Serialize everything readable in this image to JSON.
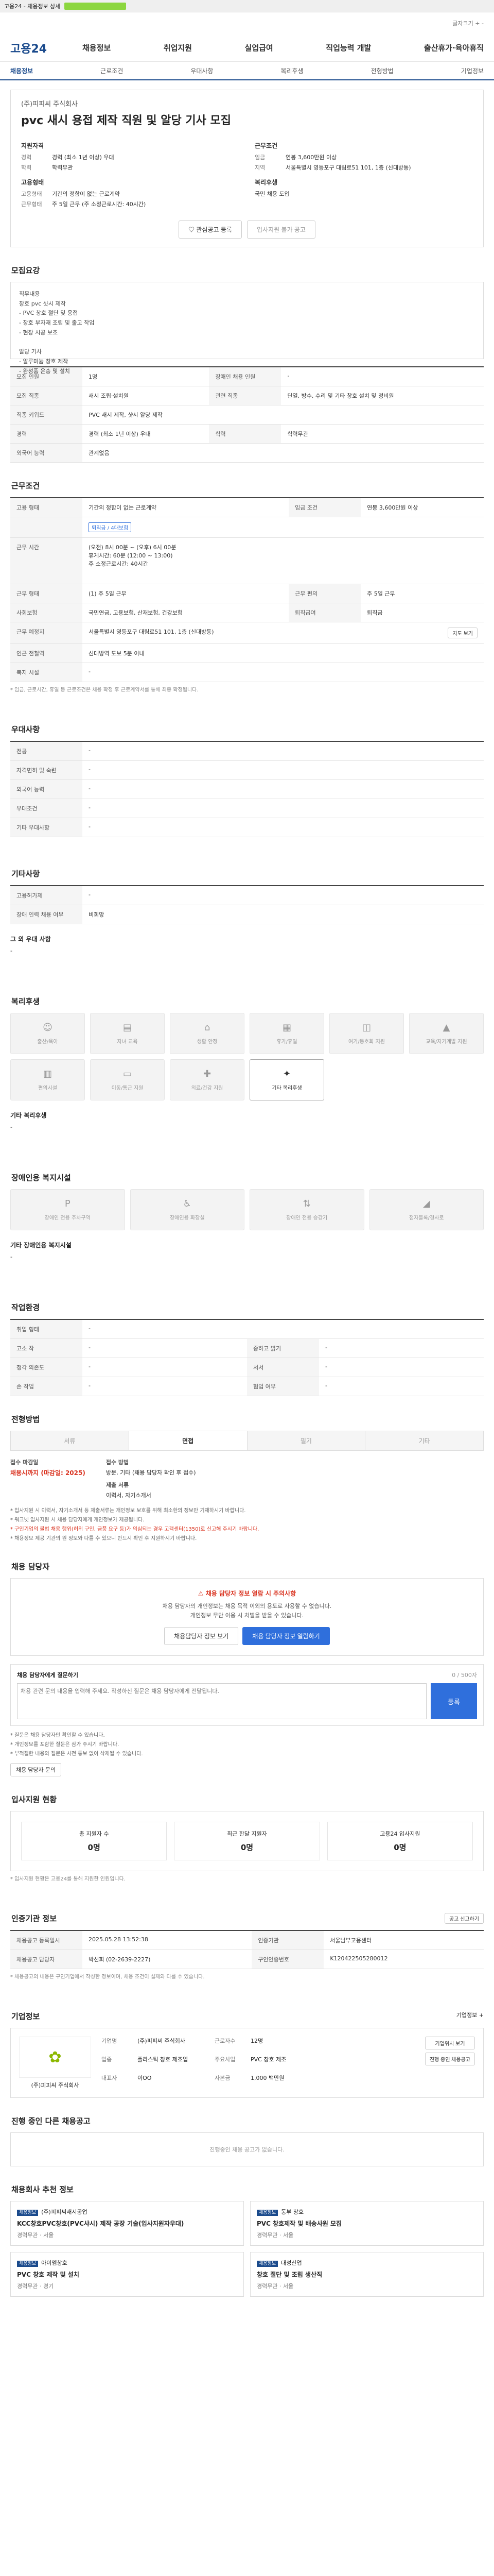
{
  "topbar": {
    "text": "고용24 - 채용정보 상세"
  },
  "util": {
    "font_label": "글자크기",
    "plus": "+",
    "minus": "-"
  },
  "gnb": {
    "logo": "고용24",
    "menu": [
      "채용정보",
      "취업지원",
      "실업급여",
      "직업능력 개발",
      "출산휴가·육아휴직"
    ]
  },
  "tabs": [
    "채용정보",
    "근로조건",
    "우대사항",
    "복리후생",
    "전형방법",
    "기업정보"
  ],
  "hero": {
    "company": "(주)피피씨 주식회사",
    "title": "pvc 새시 용접 제작 직원 및 알당 기사 모집",
    "left_title": "지원자격",
    "left": [
      {
        "k": "경력",
        "v": "경력 (최소 1년 이상) 우대"
      },
      {
        "k": "학력",
        "v": "학력무관"
      }
    ],
    "right_title": "근무조건",
    "right": [
      {
        "k": "임금",
        "v": "연봉 3,600만원 이상"
      },
      {
        "k": "지역",
        "v": "서울특별시 영등포구 대림로51 101, 1층 (신대방동)"
      }
    ],
    "left2_title": "고용형태",
    "left2": [
      {
        "k": "고용형태",
        "v": "기간의 정함이 없는 근로계약"
      },
      {
        "k": "근무형태",
        "v": "주 5일 근무 (주 소정근로시간: 40시간)"
      }
    ],
    "right2_title": "복리후생",
    "right2": [
      {
        "k": "",
        "v": "국민 채용 도입"
      }
    ],
    "btn_scrap": "관심공고 등록",
    "btn_apply": "입사지원 불가 공고"
  },
  "recruit": {
    "title": "모집요강",
    "content": "직무내용\n창호 pvc 샷시 제작\n- PVC 창호 절단 및 용접\n- 창호 부자재 조립 및 출고 작업\n- 현장 시공 보조\n\n알당 기사\n- 알루미늄 창호 제작\n- 완성품 운송 및 설치",
    "rows": [
      {
        "k1": "모집 인원",
        "v1": "1명",
        "k2": "장애인 채용 인원",
        "v2": "-"
      },
      {
        "k1": "모집 직종",
        "v1": "새시 조립·설치원",
        "k2": "관련 직종",
        "v2": "단열, 방수, 수리 및 기타 창호 설치 및 정비원"
      },
      {
        "k1": "직종 키워드",
        "v1": "PVC 새시 제작, 샷시 알당 제작",
        "k2": "",
        "v2": ""
      },
      {
        "k1": "경력",
        "v1": "경력 (최소 1년 이상) 우대",
        "k2": "학력",
        "v2": "학력무관"
      },
      {
        "k1": "외국어 능력",
        "v1": "관계없음",
        "k2": "",
        "v2": ""
      }
    ]
  },
  "conditions": {
    "title": "근무조건",
    "rows": [
      {
        "k": "고용 형태",
        "v": "기간의 정함이 없는 근로계약",
        "k2": "임금 조건",
        "v2": "연봉 3,600만원 이상"
      },
      {
        "k": "",
        "v": "퇴직금 / 4대보험",
        "k2": "",
        "v2": ""
      },
      {
        "k": "근무 시간",
        "v": "(오전) 8시 00분 ~ (오후) 6시 00분\n휴게시간: 60분 (12:00 ~ 13:00)\n주 소정근로시간: 40시간",
        "k2": "",
        "v2": ""
      },
      {
        "k": "근무 형태",
        "v": "(1) 주 5일 근무",
        "k2": "근무 편의",
        "v2": "주 5일 근무"
      },
      {
        "k": "사회보험",
        "v": "국민연금, 고용보험, 산재보험, 건강보험",
        "k2": "퇴직급여",
        "v2": "퇴직금"
      },
      {
        "k": "근무 예정지",
        "v": "서울특별시 영등포구 대림로51 101, 1층 (신대방동)",
        "k2": "",
        "v2": ""
      },
      {
        "k": "인근 전철역",
        "v": "신대방역 도보 5분 이내",
        "k2": "",
        "v2": ""
      },
      {
        "k": "복지 시설",
        "v": "-",
        "k2": "",
        "v2": ""
      }
    ],
    "map_btn": "지도 보기",
    "note": "* 임금, 근로시간, 휴일 등 근로조건은 채용 확정 후 근로계약서를 통해 최종 확정됩니다."
  },
  "prefer": {
    "title": "우대사항",
    "rows": [
      {
        "k": "전공",
        "v": "-"
      },
      {
        "k": "자격면허 및 숙련",
        "v": "-"
      },
      {
        "k": "외국어 능력",
        "v": "-"
      },
      {
        "k": "우대조건",
        "v": "-"
      },
      {
        "k": "기타 우대사항",
        "v": "-"
      }
    ]
  },
  "etc": {
    "title": "기타사항",
    "rows": [
      {
        "k": "고용허가제",
        "v": "-"
      },
      {
        "k": "장애 인력 채용 여부",
        "v": "비희망"
      }
    ],
    "extra_k": "그 외 우대 사항",
    "extra_v": "-"
  },
  "welfare": {
    "title": "복리후생",
    "items": [
      {
        "label": "출산/육아",
        "icon": "baby-icon",
        "on": false
      },
      {
        "label": "자녀 교육",
        "icon": "book-icon",
        "on": false
      },
      {
        "label": "생활 안정",
        "icon": "home-icon",
        "on": false
      },
      {
        "label": "휴가/휴일",
        "icon": "calendar-icon",
        "on": false
      },
      {
        "label": "여가/동호회 지원",
        "icon": "bag-icon",
        "on": false
      },
      {
        "label": "교육/자기계발 지원",
        "icon": "graduation-icon",
        "on": false
      },
      {
        "label": "편의시설",
        "icon": "building-icon",
        "on": false
      },
      {
        "label": "이동/통근 지원",
        "icon": "bus-icon",
        "on": false
      },
      {
        "label": "의료/건강 지원",
        "icon": "medical-icon",
        "on": false
      },
      {
        "label": "기타 복리후생",
        "icon": "gift-icon",
        "on": true
      }
    ],
    "extra_k": "기타 복리후생",
    "extra_v": "-"
  },
  "disabled": {
    "title": "장애인용 복지시설",
    "items": [
      "장애인 전용 주차구역",
      "장애인용 화장실",
      "장애인 전용 승강기",
      "점자블록/경사로"
    ],
    "extra_k": "기타 장애인용 복지시설",
    "extra_v": "-"
  },
  "worktype": {
    "title": "작업환경",
    "rows": [
      {
        "k": "취업 형태",
        "v": "-",
        "k2": "",
        "v2": ""
      },
      {
        "k": "고소 작",
        "v": "-",
        "k2": "중하고 밝기",
        "v2": "-"
      },
      {
        "k": "청각 의존도",
        "v": "-",
        "k2": "서서",
        "v2": "-"
      },
      {
        "k": "손 작업",
        "v": "-",
        "k2": "협업 여부",
        "v2": "-"
      }
    ]
  },
  "process": {
    "title": "전형방법",
    "steps": [
      "서류",
      "면접",
      "필기",
      "기타"
    ],
    "active": 1,
    "deadline_label": "접수 마감일",
    "deadline": "채용시까지 (마감일: 2025)",
    "method_label": "접수 방법",
    "method": "방문, 기타 (채용 담당자 확인 후 접수)",
    "docs_label": "제출 서류",
    "docs": "이력서, 자기소개서",
    "notice": [
      "* 입사지원 시 이력서, 자기소개서 등 제출서류는 개인정보 보호를 위해 최소한의 정보만 기재하시기 바랍니다.",
      "* 워크넷 입사지원 시 채용 담당자에게 개인정보가 제공됩니다.",
      "* 구인기업의 불법 채용 행위(허위 구인, 금품 요구 등)가 의심되는 경우 고객센터(1350)로 신고해 주시기 바랍니다.",
      "* 채용정보 제공 기관의 원 정보와 다를 수 있으니 반드시 확인 후 지원하시기 바랍니다."
    ]
  },
  "contact": {
    "title": "채용 담당자",
    "warn": "채용 담당자 정보 열람 시 주의사항",
    "desc": "채용 담당자의 개인정보는 채용 목적 이외의 용도로 사용할 수 없습니다.\n개인정보 무단 이용 시 처벌을 받을 수 있습니다.",
    "btn1": "채용담당자 정보 보기",
    "btn2": "채용 담당자 정보 열람하기"
  },
  "inquiry": {
    "title": "채용 담당자에게 질문하기",
    "count": "0 / 500자",
    "placeholder": "채용 관련 문의 내용을 입력해 주세요. 작성하신 질문은 채용 담당자에게 전달됩니다.",
    "send": "등록",
    "notice": [
      "* 질문은 채용 담당자만 확인할 수 있습니다.",
      "* 개인정보를 포함한 질문은 삼가 주시기 바랍니다.",
      "* 부적절한 내용의 질문은 사전 통보 없이 삭제될 수 있습니다."
    ],
    "btn": "채용 담당자 문의"
  },
  "applicants": {
    "title": "입사지원 현황",
    "stats": [
      {
        "label": "총 지원자 수",
        "value": "0명"
      },
      {
        "label": "최근 한달 지원자",
        "value": "0명"
      },
      {
        "label": "고용24 입사지원",
        "value": "0명"
      }
    ],
    "note": "* 입사지원 현황은 고용24를 통해 지원한 인원입니다."
  },
  "info": {
    "title": "인증기관 정보",
    "rows": [
      {
        "k": "채용공고 등록일시",
        "v": "2025.05.28 13:52:38",
        "k2": "인증기관",
        "v2": "서울남부고용센터"
      },
      {
        "k": "채용공고 담당자",
        "v": "박선희 (02-2639-2227)",
        "k2": "구인인증번호",
        "v2": "K120422505280012"
      }
    ],
    "note": "* 채용공고의 내용은 구인기업에서 작성한 정보이며, 채용 조건이 실제와 다를 수 있습니다.",
    "btn": "공고 신고하기"
  },
  "company": {
    "title": "기업정보",
    "more": "기업정보 +",
    "name": "(주)피피씨 주식회사",
    "fields": [
      {
        "k": "기업명",
        "v": "(주)피피씨 주식회사"
      },
      {
        "k": "업종",
        "v": "플라스틱 창호 제조업"
      },
      {
        "k": "대표자",
        "v": "이OO"
      },
      {
        "k": "근로자수",
        "v": "12명"
      },
      {
        "k": "주요사업",
        "v": "PVC 창호 제조"
      },
      {
        "k": "자본금",
        "v": "1,000 백만원"
      }
    ],
    "btn_map": "기업위치 보기",
    "btn_jobs": "진행 중인 채용공고"
  },
  "other_jobs": {
    "title": "진행 중인 다른 채용공고",
    "empty": "진행중인 채용 공고가 없습니다."
  },
  "related": {
    "title": "채용회사 추천 정보",
    "items": [
      {
        "badge": "채용정보",
        "company": "(주)피피씨새시공업",
        "title": "KCC창호PVC창호(PVC샤시) 제작 공장 기술(입사지원자우대)",
        "meta": "경력무관 · 서울"
      },
      {
        "badge": "채용정보",
        "company": "동부 창호",
        "title": "PVC 창호제작 및 배송사원 모집",
        "meta": "경력무관 · 서울"
      },
      {
        "badge": "채용정보",
        "company": "아이엠창호",
        "title": "PVC 창호 제작 및 설치",
        "meta": "경력무관 · 경기"
      },
      {
        "badge": "채용정보",
        "company": "대성산업",
        "title": "창호 절단 및 조립 생산직",
        "meta": "경력무관 · 서울"
      }
    ]
  },
  "colors": {
    "brand": "#1a4a8c",
    "accent": "#2f6fdc",
    "warn": "#d9311e",
    "logo_green": "#8cb800"
  }
}
